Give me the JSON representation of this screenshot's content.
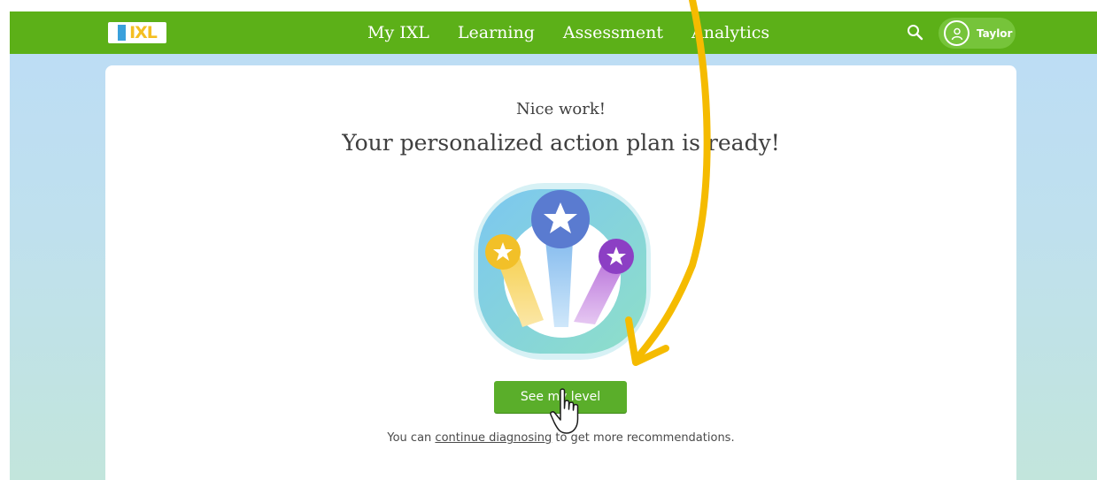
{
  "header": {
    "logo_text": "IXL",
    "nav": [
      "My IXL",
      "Learning",
      "Assessment",
      "Analytics"
    ],
    "user": {
      "name": "Taylor"
    }
  },
  "main": {
    "heading_small": "Nice work!",
    "heading_large": "Your personalized action plan is ready!",
    "cta_label": "See my level",
    "footer_prefix": "You can ",
    "footer_link": "continue diagnosing",
    "footer_suffix": " to get more recommendations."
  },
  "colors": {
    "topbar": "#5cb018",
    "button": "#5aae2a",
    "annotation_arrow": "#f5bb00"
  },
  "icons": [
    "search-icon",
    "user-icon",
    "star-icon",
    "pointer-hand-icon",
    "annotation-arrow"
  ]
}
